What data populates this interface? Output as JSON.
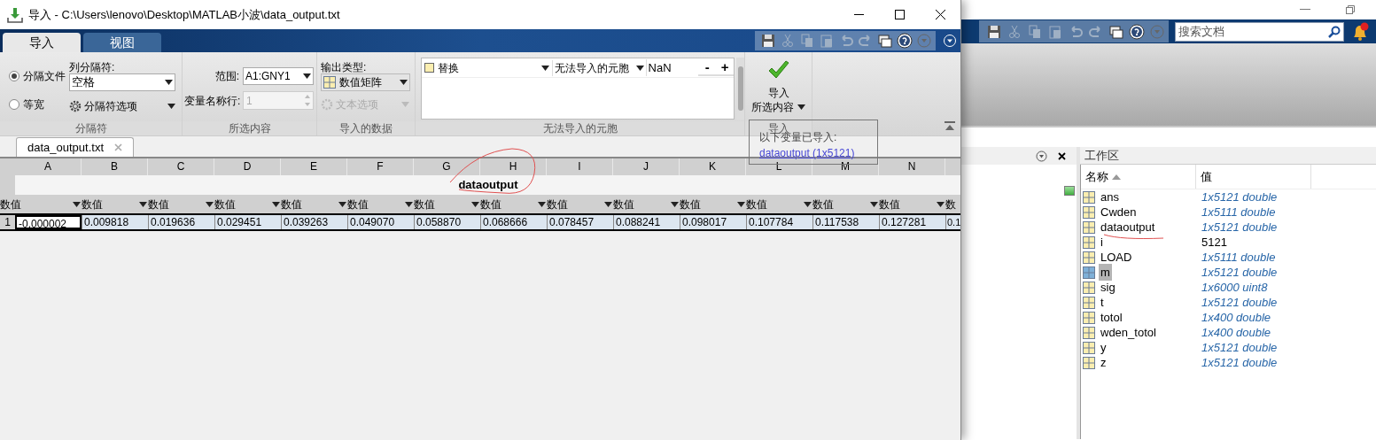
{
  "main_window": {
    "search": {
      "placeholder": "搜索文档"
    },
    "workspace": {
      "title": "工作区",
      "columns": [
        {
          "label": "名称",
          "sorted": true
        },
        {
          "label": "值",
          "sorted": false
        }
      ],
      "rows": [
        {
          "name": "ans",
          "value": "1x5121 double",
          "kind": "matrix",
          "selected": false
        },
        {
          "name": "Cwden",
          "value": "1x5111 double",
          "kind": "matrix",
          "selected": false
        },
        {
          "name": "dataoutput",
          "value": "1x5121 double",
          "kind": "matrix",
          "selected": false
        },
        {
          "name": "i",
          "value": "5121",
          "kind": "scalar",
          "selected": false
        },
        {
          "name": "LOAD",
          "value": "1x5111 double",
          "kind": "matrix",
          "selected": false
        },
        {
          "name": "m",
          "value": "1x5121 double",
          "kind": "matrix",
          "selected": true
        },
        {
          "name": "sig",
          "value": "1x6000 uint8",
          "kind": "matrix",
          "selected": false
        },
        {
          "name": "t",
          "value": "1x5121 double",
          "kind": "matrix",
          "selected": false
        },
        {
          "name": "totol",
          "value": "1x400 double",
          "kind": "matrix",
          "selected": false
        },
        {
          "name": "wden_totol",
          "value": "1x400 double",
          "kind": "matrix",
          "selected": false
        },
        {
          "name": "y",
          "value": "1x5121 double",
          "kind": "matrix",
          "selected": false
        },
        {
          "name": "z",
          "value": "1x5121 double",
          "kind": "matrix",
          "selected": false
        }
      ]
    }
  },
  "import_window": {
    "title": "导入 - C:\\Users\\lenovo\\Desktop\\MATLAB小波\\data_output.txt",
    "tabs": [
      {
        "label": "导入",
        "selected": true
      },
      {
        "label": "视图",
        "selected": false
      }
    ],
    "delimiter_group": {
      "label": "分隔符",
      "options": [
        {
          "label": "分隔文件",
          "selected": true
        },
        {
          "label": "等宽",
          "selected": false
        }
      ],
      "column_delimiter_label": "列分隔符:",
      "column_delimiter": "空格",
      "options_button": "分隔符选项"
    },
    "selection_group": {
      "label": "所选内容",
      "range_label": "范围:",
      "range": "A1:GNY1",
      "varname_label": "变量名称行:",
      "varname_row": "1"
    },
    "imported_data_group": {
      "label": "导入的数据",
      "output_type_label": "输出类型:",
      "output_type": "数值矩阵",
      "text_options": {
        "label": "文本选项",
        "disabled": true
      }
    },
    "unimportable_group": {
      "label": "无法导入的元胞",
      "rule": {
        "action": "替换",
        "target": "无法导入的元胞",
        "value": "NaN"
      },
      "buttons": [
        "-",
        "+"
      ]
    },
    "import_group": {
      "label": "导入",
      "button": [
        "导入",
        "所选内容"
      ]
    },
    "document_tab": "data_output.txt",
    "grid": {
      "columns": [
        "A",
        "B",
        "C",
        "D",
        "E",
        "F",
        "G",
        "H",
        "I",
        "J",
        "K",
        "L",
        "M",
        "N"
      ],
      "variable_name": "dataoutput",
      "types": [
        "数值",
        "数值",
        "数值",
        "数值",
        "数值",
        "数值",
        "数值",
        "数值",
        "数值",
        "数值",
        "数值",
        "数值",
        "数值",
        "数值",
        "数"
      ],
      "rows": [
        {
          "header": "1",
          "cells": [
            "-0.000002",
            "0.009818",
            "0.019636",
            "0.029451",
            "0.039263",
            "0.049070",
            "0.058870",
            "0.068666",
            "0.078457",
            "0.088241",
            "0.098017",
            "0.107784",
            "0.117538",
            "0.127281",
            "0.1"
          ]
        }
      ]
    },
    "tooltip": {
      "text": "以下变量已导入:",
      "link": "dataoutput (1x5121)"
    }
  }
}
